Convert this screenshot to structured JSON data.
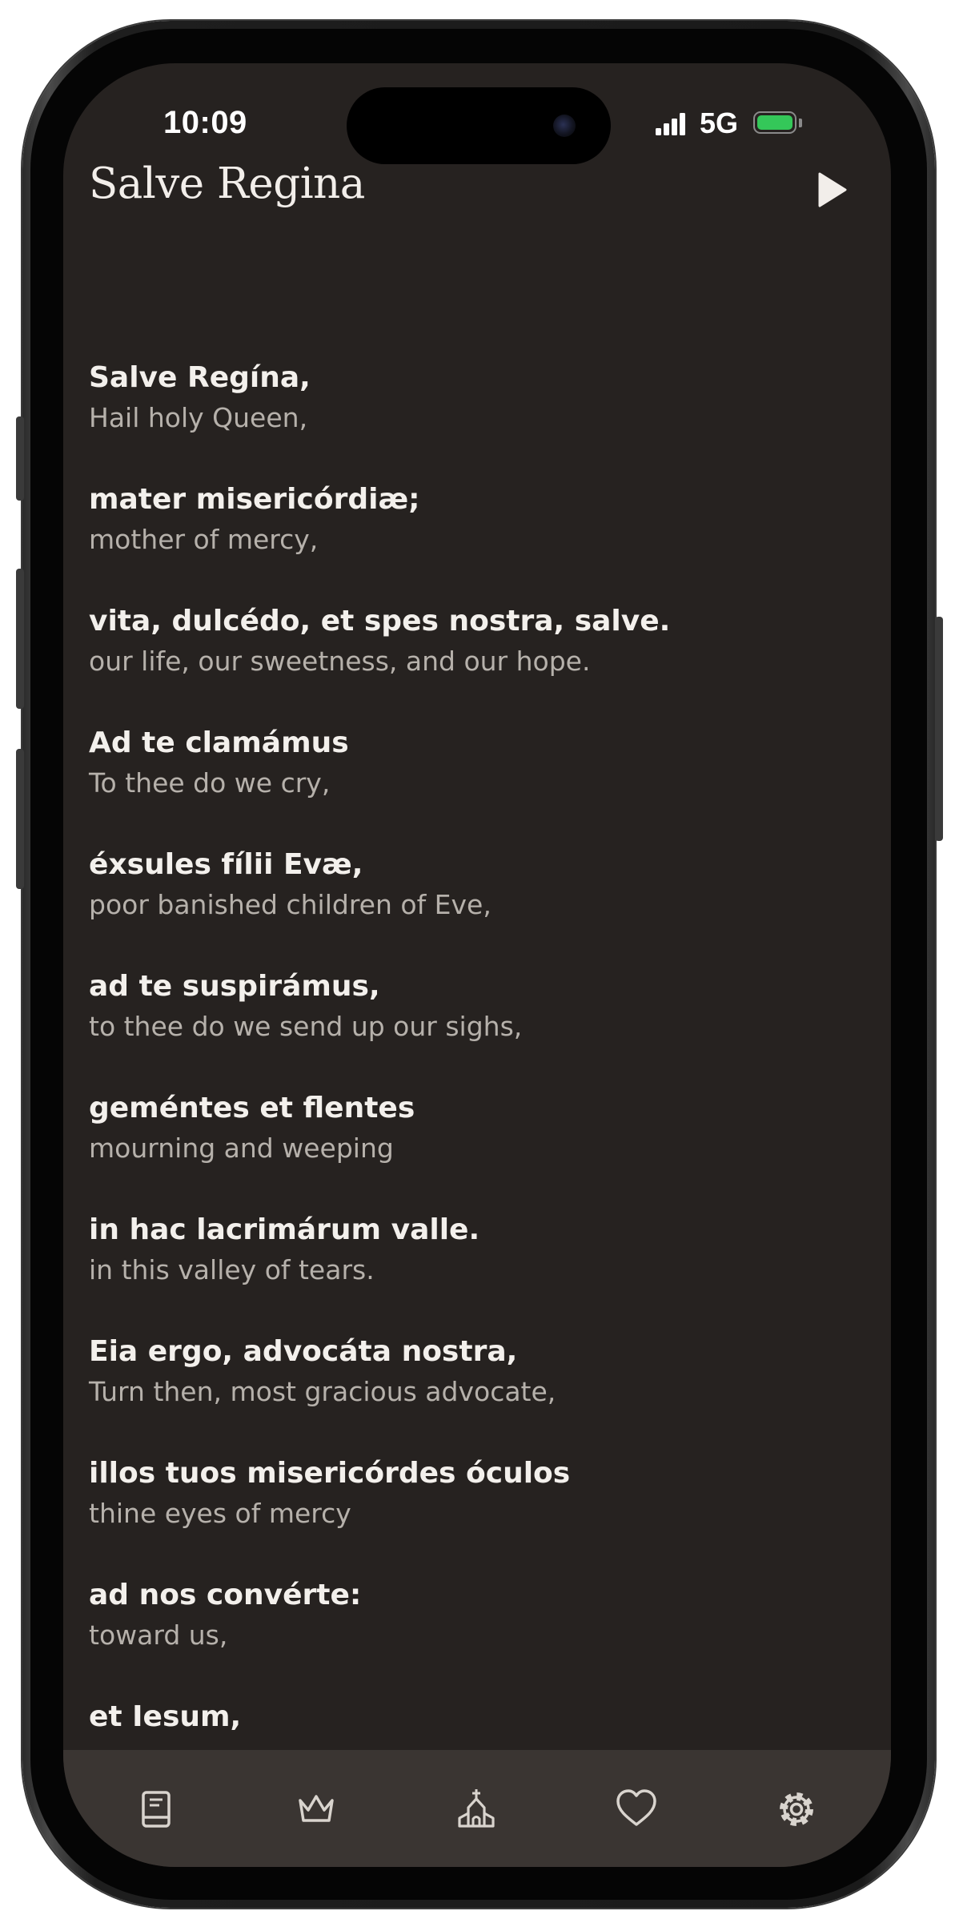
{
  "status_bar": {
    "time": "10:09",
    "network": "5G",
    "battery_color": "#34c759"
  },
  "header": {
    "title": "Salve Regina",
    "play_icon": "play-icon"
  },
  "prayer": {
    "verses": [
      {
        "latin": "Salve Regína,",
        "english": "Hail holy Queen,"
      },
      {
        "latin": "mater misericórdiæ;",
        "english": "mother of mercy,"
      },
      {
        "latin": "vita, dulcédo, et spes nostra, salve.",
        "english": "our life, our sweetness, and our hope."
      },
      {
        "latin": "Ad te clamámus",
        "english": "To thee do we cry,"
      },
      {
        "latin": "éxsules fílii Evæ,",
        "english": "poor banished children of Eve,"
      },
      {
        "latin": "ad te suspirámus,",
        "english": "to thee do we send up our sighs,"
      },
      {
        "latin": "geméntes et flentes",
        "english": "mourning and weeping"
      },
      {
        "latin": "in hac lacrimárum valle.",
        "english": "in this valley of tears."
      },
      {
        "latin": "Eia ergo, advocáta nostra,",
        "english": "Turn then, most gracious advocate,"
      },
      {
        "latin": "illos tuos misericórdes óculos",
        "english": "thine eyes of mercy"
      },
      {
        "latin": "ad nos convérte:",
        "english": "toward us,"
      },
      {
        "latin": "et Iesum,",
        "english": ""
      }
    ]
  },
  "tab_bar": {
    "background": "#3a3532",
    "icons": [
      "book-icon",
      "crown-icon",
      "church-icon",
      "heart-icon",
      "gear-icon"
    ]
  },
  "colors": {
    "screen_background": "#262220",
    "latin_text": "#f3f0ec",
    "english_text": "#b6b1ab"
  }
}
